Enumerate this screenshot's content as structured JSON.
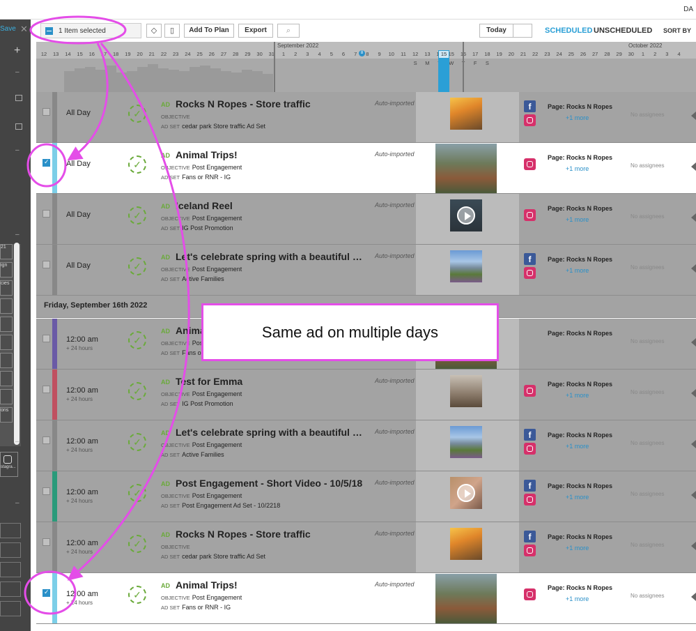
{
  "topstrip": {
    "corner": "DA"
  },
  "sidebar": {
    "save": "Save",
    "plus": "+",
    "items": [
      "21",
      "ign",
      "cies",
      "ons",
      "stagra..."
    ]
  },
  "toolbar": {
    "selected_label": "1 Item selected",
    "add_to_plan": "Add To Plan",
    "export": "Export",
    "today": "Today",
    "tab_scheduled": "SCHEDULED",
    "tab_unscheduled": "UNSCHEDULED",
    "sort_by": "SORT BY"
  },
  "timeline": {
    "months": [
      "September 2022",
      "October 2022"
    ],
    "days": [
      "12",
      "13",
      "14",
      "15",
      "16",
      "17",
      "18",
      "19",
      "20",
      "21",
      "22",
      "23",
      "24",
      "25",
      "26",
      "27",
      "28",
      "29",
      "30",
      "31",
      "1",
      "2",
      "3",
      "4",
      "5",
      "6",
      "7",
      "8",
      "9",
      "10",
      "11",
      "12",
      "13",
      "14",
      "15",
      "16",
      "17",
      "18",
      "19",
      "20",
      "21",
      "22",
      "23",
      "24",
      "25",
      "26",
      "27",
      "28",
      "29",
      "30",
      "1",
      "2",
      "3",
      "4"
    ],
    "weekdays": [
      "S",
      "M",
      "T",
      "W",
      "T",
      "F",
      "S"
    ],
    "today_day": "15",
    "marker": "8"
  },
  "day_header": "Friday, September 16th 2022",
  "labels": {
    "ad": "AD",
    "objective": "OBJECTIVE",
    "adset": "AD SET",
    "auto": "Auto-imported",
    "more": "+1 more",
    "assignees": "No assignees"
  },
  "rows": [
    {
      "time": "All Day",
      "dur": "",
      "title": "Rocks N Ropes - Store traffic",
      "objective": "",
      "adset": "cedar park Store traffic Ad Set",
      "auto": "Auto-imported",
      "page": "Page: Rocks N Ropes",
      "more": "+1 more",
      "selected": false
    },
    {
      "time": "All Day",
      "dur": "",
      "title": "Animal Trips!",
      "objective": "Post Engagement",
      "adset": "Fans or RNR - IG",
      "auto": "Auto-imported",
      "page": "Page: Rocks N Ropes",
      "more": "+1 more",
      "selected": true
    },
    {
      "time": "All Day",
      "dur": "",
      "title": "Iceland Reel",
      "objective": "Post Engagement",
      "adset": "IG Post Promotion",
      "auto": "Auto-imported",
      "page": "Page: Rocks N Ropes",
      "more": "+1 more",
      "selected": false
    },
    {
      "time": "All Day",
      "dur": "",
      "title": "Let's celebrate spring with a beautiful hi...",
      "objective": "Post Engagement",
      "adset": "Active Families",
      "auto": "Auto-imported",
      "page": "Page: Rocks N Ropes",
      "more": "+1 more",
      "selected": false
    },
    {
      "time": "12:00 am",
      "dur": "+ 24 hours",
      "title": "Animal Trips!",
      "objective": "Post Engagement",
      "adset": "Fans or RNR - IG",
      "auto": "",
      "page": "Page: Rocks N Ropes",
      "more": "",
      "selected": false
    },
    {
      "time": "12:00 am",
      "dur": "+ 24 hours",
      "title": "Test for Emma",
      "objective": "Post Engagement",
      "adset": "IG Post Promotion",
      "auto": "Auto-imported",
      "page": "Page: Rocks N Ropes",
      "more": "+1 more",
      "selected": false
    },
    {
      "time": "12:00 am",
      "dur": "+ 24 hours",
      "title": "Let's celebrate spring with a beautiful hi...",
      "objective": "Post Engagement",
      "adset": "Active Families",
      "auto": "Auto-imported",
      "page": "Page: Rocks N Ropes",
      "more": "+1 more",
      "selected": false
    },
    {
      "time": "12:00 am",
      "dur": "+ 24 hours",
      "title": "Post Engagement - Short Video - 10/5/18",
      "objective": "Post Engagement",
      "adset": "Post Engagement Ad Set - 10/2218",
      "auto": "Auto-imported",
      "page": "Page: Rocks N Ropes",
      "more": "+1 more",
      "selected": false
    },
    {
      "time": "12:00 am",
      "dur": "+ 24 hours",
      "title": "Rocks N Ropes - Store traffic",
      "objective": "",
      "adset": "cedar park Store traffic Ad Set",
      "auto": "Auto-imported",
      "page": "Page: Rocks N Ropes",
      "more": "+1 more",
      "selected": false
    },
    {
      "time": "12:00 am",
      "dur": "+ 24 hours",
      "title": "Animal Trips!",
      "objective": "Post Engagement",
      "adset": "Fans or RNR - IG",
      "auto": "Auto-imported",
      "page": "Page: Rocks N Ropes",
      "more": "+1 more",
      "selected": true
    }
  ],
  "callout": "Same ad on multiple days",
  "colors": {
    "accent": "#2a9fd6",
    "annotation": "#e44de8",
    "status_green": "#6aaa3a"
  }
}
